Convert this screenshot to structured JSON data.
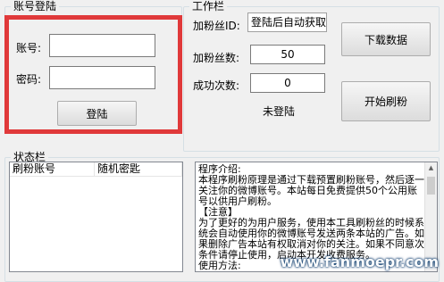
{
  "account_group": {
    "title": "账号登陆",
    "username_label": "账号:",
    "username_value": "",
    "password_label": "密码:",
    "password_value": "",
    "login_button": "登陆"
  },
  "work_group": {
    "title": "工作栏",
    "fan_id_label": "加粉丝ID:",
    "fan_id_value": "登陆后自动获取",
    "fan_count_label": "加粉丝数:",
    "fan_count_value": "50",
    "success_label": "成功次数:",
    "success_value": "0",
    "status_text": "未登陆",
    "download_button": "下载数据",
    "start_button": "开始刷粉"
  },
  "status_group": {
    "title": "状态栏",
    "columns": [
      "刷粉账号",
      "随机密匙"
    ]
  },
  "intro": {
    "lines": [
      "程序介绍:",
      "本程序刷粉原理是通过下载预置刷粉账号，然后逐一关注你的微博账号。本站每日免费提供50个公用账号以供用户刷粉。",
      "【注意】",
      "为了更好的为用户服务，使用本工具刷粉丝的时候系统会自动使用你的微博账号发送两条本站的广告。如果删除广告本站有权取消对你的关注。如果不同意次条件请停止使用，启动本开发收费服务。",
      "使用方法:"
    ]
  },
  "watermark": "www.fanmoepr.com",
  "colors": {
    "highlight": "#e0393a",
    "window_bg": "#f0f0f0"
  }
}
